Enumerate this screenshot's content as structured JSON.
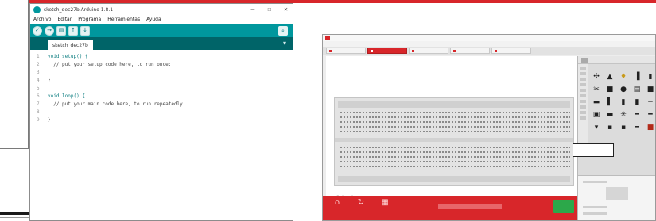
{
  "page": {
    "top_caption": ""
  },
  "arduino": {
    "title": "sketch_dec27b Arduino 1.8.1",
    "window_controls": {
      "minimize": "—",
      "maximize": "☐",
      "close": "✕"
    },
    "menu": [
      "Archivo",
      "Editar",
      "Programa",
      "Herramientas",
      "Ayuda"
    ],
    "toolbar": {
      "verify": "✓",
      "upload": "→",
      "new": "▤",
      "open": "↑",
      "save": "↓",
      "serial_monitor": "⌕"
    },
    "tab": {
      "label": "sketch_dec27b",
      "menu_glyph": "▾"
    },
    "code_lines": [
      {
        "num": "1",
        "text": "void setup() {"
      },
      {
        "num": "2",
        "text": "  // put your setup code here, to run once:"
      },
      {
        "num": "3",
        "text": ""
      },
      {
        "num": "4",
        "text": "}"
      },
      {
        "num": "5",
        "text": ""
      },
      {
        "num": "6",
        "text": "void loop() {"
      },
      {
        "num": "7",
        "text": "  // put your main code here, to run repeatedly:"
      },
      {
        "num": "8",
        "text": ""
      },
      {
        "num": "9",
        "text": "}"
      }
    ],
    "colors": {
      "teal": "#00979d",
      "dark_teal": "#006468"
    }
  },
  "fritzing": {
    "title": "",
    "menu": [
      "",
      "",
      "",
      "",
      "",
      "",
      "",
      ""
    ],
    "tabs": [
      {
        "label": "",
        "active": false
      },
      {
        "label": "",
        "active": true
      },
      {
        "label": "",
        "active": false
      },
      {
        "label": "",
        "active": false
      },
      {
        "label": "",
        "active": false
      }
    ],
    "brand": "fritzing",
    "bottom_buttons": [
      {
        "icon": "⌂",
        "label": ""
      },
      {
        "icon": "↻",
        "label": ""
      },
      {
        "icon": "▦",
        "label": ""
      }
    ],
    "status_text": "",
    "parts_panel": {
      "icons": [
        "✣",
        "▲",
        "♦",
        "▐",
        "▮",
        "✂",
        "■",
        "●",
        "▤",
        "■",
        "▬",
        "▌",
        "▮",
        "▮",
        "━",
        "▣",
        "▬",
        "✳",
        "━",
        "━",
        "▾",
        "▪",
        "▪",
        "━",
        "■"
      ]
    },
    "callout_label": "",
    "colors": {
      "red": "#d8262a",
      "green": "#2ca84a"
    }
  }
}
